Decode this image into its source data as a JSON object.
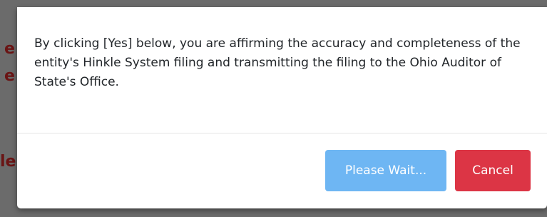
{
  "background": {
    "fragments": [
      "e",
      "e",
      "le"
    ]
  },
  "dialog": {
    "message": "By clicking [Yes] below, you are affirming the accuracy and completeness of the entity's Hinkle System filing and transmitting the filing to the Ohio Auditor of State's Office.",
    "buttons": {
      "wait_label": "Please Wait...",
      "cancel_label": "Cancel"
    }
  },
  "colors": {
    "wait_button": "#6eb6f3",
    "cancel_button": "#dc3545",
    "backdrop": "#6b6b6b",
    "background_text": "#6a1414"
  }
}
